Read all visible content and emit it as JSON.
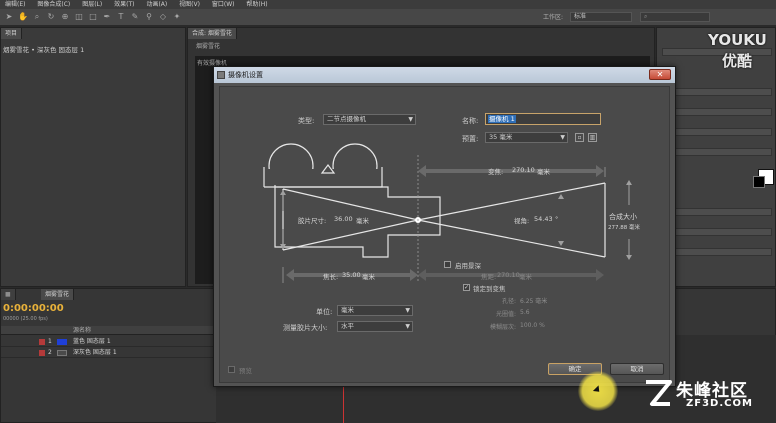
{
  "menubar": {
    "items": [
      "编辑(E)",
      "图像合成(C)",
      "图层(L)",
      "效果(T)",
      "动画(A)",
      "视图(V)",
      "窗口(W)",
      "帮助(H)"
    ]
  },
  "toolbar": {
    "workspace_label": "工作区:",
    "workspace_value": "标准"
  },
  "project_panel": {
    "tab": "项目",
    "selected_item": "烟雾雪花 • 深灰色 固态层 1"
  },
  "comp_panel": {
    "tab": "合成: 烟雾雪花",
    "sub_label": "烟雾雪花",
    "active_camera": "有效摄像机"
  },
  "timeline": {
    "tab": "烟雾雪花",
    "timecode": "0:00:00:00",
    "fps": "00000 (25.00 fps)",
    "col_source": "源名称",
    "layers": [
      {
        "num": "1",
        "name": "蓝色 固态层 1",
        "color": "#1f3fd6"
      },
      {
        "num": "2",
        "name": "深灰色 固态层 1",
        "color": "#4a4a4a"
      }
    ]
  },
  "watermarks": {
    "youku_1": "YOUKU",
    "youku_2": "优酷",
    "zf_big": "朱峰社区",
    "zf_small": "ZF3D.COM"
  },
  "dialog": {
    "title": "摄像机设置",
    "close": "✕",
    "type_label": "类型:",
    "type_value": "二节点摄像机",
    "name_label": "名称:",
    "name_value": "摄像机 1",
    "preset_label": "预置:",
    "preset_value": "35 毫米",
    "zoom_label": "变焦:",
    "zoom_value": "270.10",
    "zoom_unit": "毫米",
    "film_label": "胶片尺寸:",
    "film_value": "36.00",
    "film_unit": "毫米",
    "angle_label": "视角:",
    "angle_value": "54.43",
    "angle_unit": "°",
    "comp_size_label": "合成大小",
    "comp_size_value": "277.88 毫米",
    "focal_label": "焦长:",
    "focal_value": "35.00",
    "focal_unit": "毫米",
    "dof_label": "启用景深",
    "focus_dist_label": "焦距:",
    "focus_dist_value": "270.10",
    "focus_dist_unit": "毫米",
    "lock_zoom_label": "锁定到变焦",
    "aperture_label": "孔径:",
    "aperture_value": "6.25 毫米",
    "fstop_label": "光圈值:",
    "fstop_value": "5.6",
    "blur_label": "模糊层次:",
    "blur_value": "100.0 %",
    "units_label": "单位:",
    "units_value": "毫米",
    "measure_label": "测量胶片大小:",
    "measure_value": "水平",
    "preview_label": "预览",
    "ok": "确定",
    "cancel": "取消",
    "dof_checked": false,
    "lock_zoom_checked": true
  }
}
